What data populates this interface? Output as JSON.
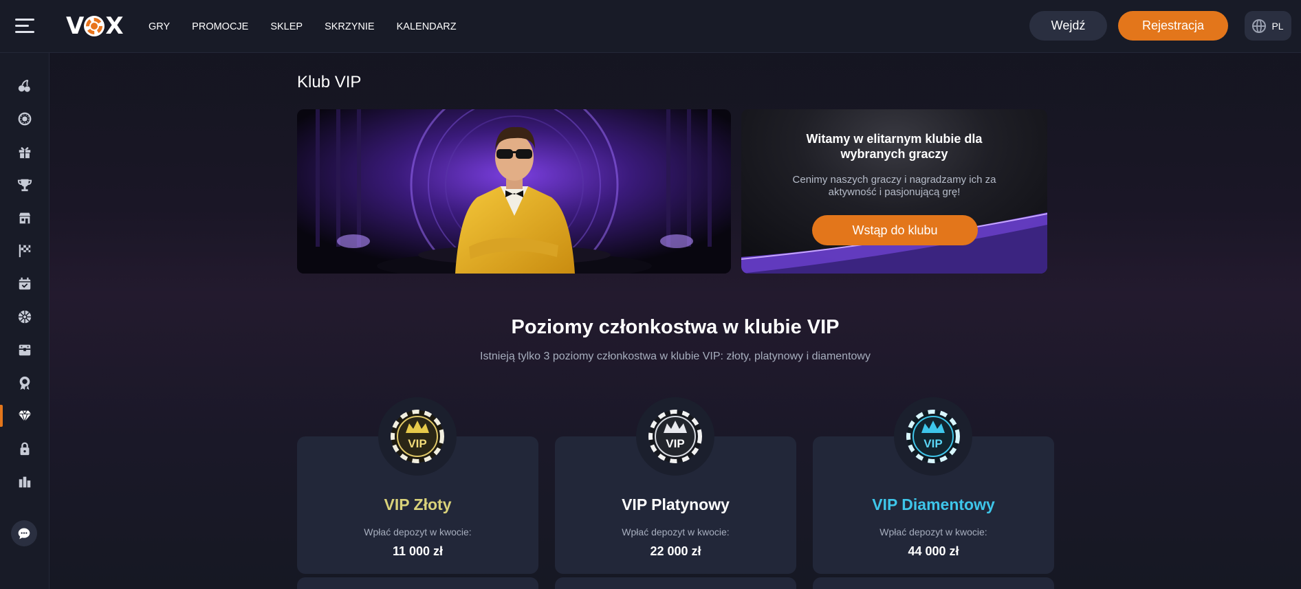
{
  "header": {
    "logo_text_left": "V",
    "logo_text_right": "X",
    "nav": [
      "GRY",
      "PROMOCJE",
      "SKLEP",
      "SKRZYNIE",
      "KALENDARZ"
    ],
    "login_label": "Wejdź",
    "register_label": "Rejestracja",
    "language": "PL"
  },
  "sidebar": {
    "items": [
      {
        "icon": "cherries-icon"
      },
      {
        "icon": "roulette-icon"
      },
      {
        "icon": "gift-icon"
      },
      {
        "icon": "trophy-icon"
      },
      {
        "icon": "shop-icon"
      },
      {
        "icon": "race-flag-icon"
      },
      {
        "icon": "calendar-icon"
      },
      {
        "icon": "wheel-icon"
      },
      {
        "icon": "chest-icon"
      },
      {
        "icon": "badge-icon"
      },
      {
        "icon": "diamond-icon",
        "active": true
      },
      {
        "icon": "lock-icon"
      },
      {
        "icon": "tournament-icon"
      }
    ],
    "chat_icon": "chat-icon"
  },
  "main": {
    "title": "Klub VIP",
    "promo": {
      "heading": "Witamy w elitarnym klubie dla wybranych graczy",
      "text": "Cenimy naszych graczy i nagradzamy ich za aktywność i pasjonującą grę!",
      "button": "Wstąp do klubu"
    },
    "levels_title": "Poziomy członkostwa w klubie VIP",
    "levels_subtitle": "Istnieją tylko 3 poziomy członkostwa w klubie VIP: złoty, platynowy i diamentowy",
    "levels": [
      {
        "name": "VIP Złoty",
        "label": "Wpłać depozyt w kwocie:",
        "amount": "11 000 zł",
        "color": "#d9d27a",
        "chip_text": "VIP"
      },
      {
        "name": "VIP Platynowy",
        "label": "Wpłać depozyt w kwocie:",
        "amount": "22 000 zł",
        "color": "#ffffff",
        "chip_text": "VIP"
      },
      {
        "name": "VIP Diamentowy",
        "label": "Wpłać depozyt w kwocie:",
        "amount": "44 000 zł",
        "color": "#3ec6ea",
        "chip_text": "VIP"
      }
    ]
  },
  "colors": {
    "accent": "#e3761b",
    "gold": "#d9d27a",
    "diamond": "#3ec6ea"
  }
}
